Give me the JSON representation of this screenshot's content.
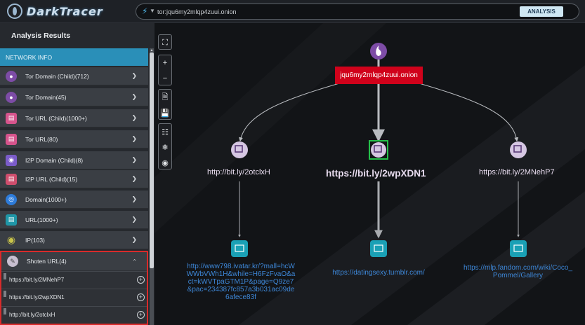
{
  "header": {
    "logo_text": "DarkTracer",
    "search_value": "tor:jqu6my2mlqp4zuui.onion",
    "analysis_label": "ANALYSIS"
  },
  "sidebar": {
    "title": "Analysis Results",
    "section": "NETWORK INFO",
    "items": [
      {
        "label": "Tor Domain (Child)(712)",
        "icon": "tor-onion-icon"
      },
      {
        "label": "Tor Domain(45)",
        "icon": "tor-onion-icon"
      },
      {
        "label": "Tor URL (Child)(1000+)",
        "icon": "tor-url-icon"
      },
      {
        "label": "Tor URL(80)",
        "icon": "tor-url-icon"
      },
      {
        "label": "I2P Domain (Child)(8)",
        "icon": "i2p-icon"
      },
      {
        "label": "I2P URL (Child)(15)",
        "icon": "i2p-url-icon"
      },
      {
        "label": "Domain(1000+)",
        "icon": "globe-icon"
      },
      {
        "label": "URL(1000+)",
        "icon": "url-icon"
      },
      {
        "label": "IP(103)",
        "icon": "map-pin-icon"
      }
    ],
    "shorten": {
      "label": "Shoten URL(4)",
      "items": [
        "https://bit.ly/2MNehP7",
        "https://bit.ly/2wpXDN1",
        "http://bit.ly/2otclxH"
      ]
    }
  },
  "graph": {
    "root": "jqu6my2mlqp4zuui.onion",
    "shorten_nodes": [
      "http://bit.ly/2otclxH",
      "https://bit.ly/2wpXDN1",
      "https://bit.ly/2MNehP7"
    ],
    "leaf_nodes": [
      [
        "http://www798.ivatar.kr/?mall=hcW",
        "WWbVWh1H&while=H6FzFvaO&a",
        "ct=kWVTpaGTM1P&page=Q9ze7",
        "&pac=234387fc857a3b031ac09de",
        "6afece83f"
      ],
      [
        "https://datingsexy.tumblr.com/"
      ],
      [
        "https://mlp.fandom.com/wiki/Coco_",
        "Pommel/Gallery"
      ]
    ],
    "shorten_icon_caption": "shorten"
  },
  "colors": {
    "accent": "#2a8fb8",
    "root_bg": "#d0021b",
    "highlight": "#d92b2b",
    "link": "#3d86d6"
  }
}
